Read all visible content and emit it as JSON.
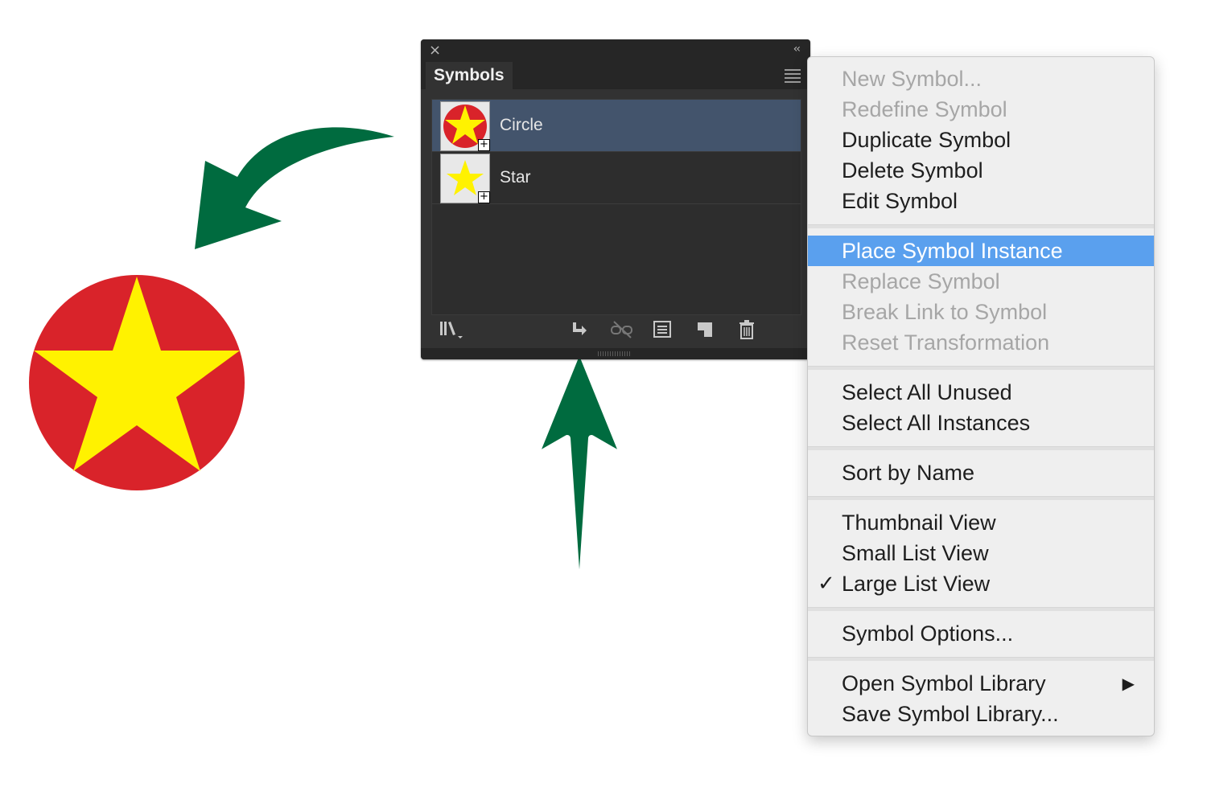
{
  "panel": {
    "close_icon": "×",
    "collapse_icon": "‹‹",
    "tab_label": "Symbols",
    "symbols": [
      {
        "name": "Circle",
        "selected": true,
        "thumb": "circle-star"
      },
      {
        "name": "Star",
        "selected": false,
        "thumb": "star"
      }
    ],
    "toolbar_icons": [
      "library-icon",
      "place-instance-icon",
      "break-link-icon",
      "symbol-options-icon",
      "new-symbol-icon",
      "delete-icon"
    ]
  },
  "menu": {
    "items": [
      {
        "label": "New Symbol...",
        "state": "disabled"
      },
      {
        "label": "Redefine Symbol",
        "state": "disabled"
      },
      {
        "label": "Duplicate Symbol",
        "state": "enabled"
      },
      {
        "label": "Delete Symbol",
        "state": "enabled"
      },
      {
        "label": "Edit Symbol",
        "state": "enabled"
      },
      {
        "label": "Place Symbol Instance",
        "state": "highlighted"
      },
      {
        "label": "Replace Symbol",
        "state": "disabled"
      },
      {
        "label": "Break Link to Symbol",
        "state": "disabled"
      },
      {
        "label": "Reset Transformation",
        "state": "disabled"
      },
      {
        "label": "Select All Unused",
        "state": "enabled"
      },
      {
        "label": "Select All Instances",
        "state": "enabled"
      },
      {
        "label": "Sort by Name",
        "state": "enabled"
      },
      {
        "label": "Thumbnail View",
        "state": "enabled"
      },
      {
        "label": "Small List View",
        "state": "enabled"
      },
      {
        "label": "Large List View",
        "state": "checked"
      },
      {
        "label": "Symbol Options...",
        "state": "enabled"
      },
      {
        "label": "Open Symbol Library",
        "state": "submenu"
      },
      {
        "label": "Save Symbol Library...",
        "state": "enabled"
      }
    ],
    "check_mark": "✓",
    "submenu_arrow": "▶"
  },
  "colors": {
    "arrow_green": "#006b3f",
    "circle_red": "#d9232a",
    "star_yellow": "#fff200",
    "highlight_blue": "#5aa0ee"
  }
}
